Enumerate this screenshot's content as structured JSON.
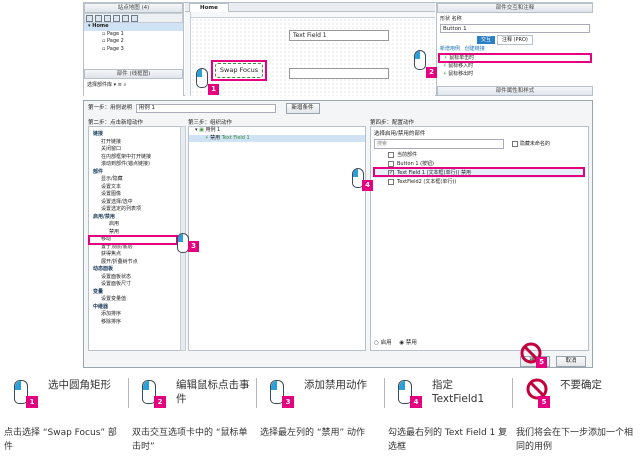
{
  "sitemap": {
    "title": "站点地图 (4)",
    "home": "Home",
    "pages": [
      "Page 1",
      "Page 2",
      "Page 3"
    ]
  },
  "widgets_panel": {
    "title": "部件 (线框图)",
    "filter": "选择部件库"
  },
  "canvas": {
    "tab": "Home",
    "textfield": "Text Field 1",
    "swap_focus": "Swap Focus"
  },
  "interaction_panel": {
    "title": "部件交互和注释",
    "shape_name_label": "形状 名称",
    "name_value": "Button 1",
    "tab_interaction": "交互",
    "tab_notes": "注释 (PRO)",
    "link_new": "新增用例",
    "link_create": "创建链接",
    "events": [
      "鼠标单击时",
      "鼠标移入时",
      "鼠标移出时"
    ],
    "props_title": "部件属性和样式"
  },
  "dialog": {
    "case_name_label": "第一步：用例说明",
    "case_name_value": "用例 1",
    "add_condition": "新增条件",
    "step2": "第二步：点击新增动作",
    "step3": "第三步：组织动作",
    "step4": "第四步：配置动作",
    "action_tree": [
      {
        "label": "链接",
        "level": 0
      },
      {
        "label": "打开链接",
        "level": 1
      },
      {
        "label": "关闭窗口",
        "level": 1
      },
      {
        "label": "在内部框架中打开链接",
        "level": 1
      },
      {
        "label": "滚动到部件(锚点链接)",
        "level": 1
      },
      {
        "label": "部件",
        "level": 0
      },
      {
        "label": "显示/隐藏",
        "level": 1
      },
      {
        "label": "设置文本",
        "level": 1
      },
      {
        "label": "设置图像",
        "level": 1
      },
      {
        "label": "设置选择/选中",
        "level": 1
      },
      {
        "label": "设置选定的列表项",
        "level": 1
      },
      {
        "label": "启用/禁用",
        "level": 0
      },
      {
        "label": "启用",
        "level": 2
      },
      {
        "label": "禁用",
        "level": 2
      },
      {
        "label": "移动",
        "level": 1
      },
      {
        "label": "置于顶层/底层",
        "level": 1
      },
      {
        "label": "获得焦点",
        "level": 1
      },
      {
        "label": "展开/折叠树节点",
        "level": 1
      },
      {
        "label": "动态面板",
        "level": 0
      },
      {
        "label": "设置面板状态",
        "level": 1
      },
      {
        "label": "设置面板尺寸",
        "level": 1
      },
      {
        "label": "变量",
        "level": 0
      },
      {
        "label": "设置变量值",
        "level": 1
      },
      {
        "label": "中继器",
        "level": 0
      },
      {
        "label": "添加排序",
        "level": 1
      },
      {
        "label": "移除排序",
        "level": 1
      }
    ],
    "organize": {
      "case": "用例 1",
      "action": "禁用",
      "target": "Text Field 1"
    },
    "config": {
      "choose_label": "选择启用/禁用的部件",
      "search_placeholder": "搜索",
      "hide_unnamed": "隐藏未命名的",
      "items": [
        "当前部件",
        "Button 1 (按钮)",
        "Text Field 1 (文本框(单行)) 禁用",
        "TextField2 (文本框(单行))"
      ],
      "radio_enable": "启用",
      "radio_disable": "禁用"
    },
    "ok": "确定",
    "cancel": "取消"
  },
  "badges": [
    "1",
    "2",
    "3",
    "4",
    "5"
  ],
  "legend": [
    {
      "num": "1",
      "title": "选中圆角矩形",
      "desc": "点击选择 “Swap Focus” 部件"
    },
    {
      "num": "2",
      "title": "编辑鼠标点击事件",
      "desc": "双击交互选项卡中的 “鼠标单击时”"
    },
    {
      "num": "3",
      "title": "添加禁用动作",
      "desc": "选择最左列的 “禁用” 动作"
    },
    {
      "num": "4",
      "title": "指定 TextField1",
      "desc": "勾选最右列的 Text Field 1 复选框"
    },
    {
      "num": "5",
      "title": "不要确定",
      "desc": "我们将会在下一步添加一个相同的用例"
    }
  ],
  "colors": {
    "accent": "#e5007f",
    "mouse_blue": "#2b9fd8"
  }
}
